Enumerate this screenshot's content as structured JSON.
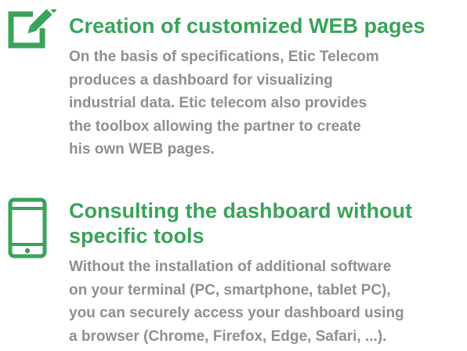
{
  "colors": {
    "accent": "#3aa35a",
    "body_text": "#8f8f8f"
  },
  "features": [
    {
      "icon": "edit-icon",
      "title_lines": [
        "Creation of customized WEB pages"
      ],
      "description_lines": [
        "On the basis of specifications, Etic Telecom",
        "produces a dashboard for visualizing",
        "industrial data. Etic telecom also provides",
        "the toolbox allowing the partner to create",
        "his own WEB pages."
      ]
    },
    {
      "icon": "tablet-icon",
      "title_lines": [
        "Consulting the dashboard without",
        "specific tools"
      ],
      "description_lines": [
        "Without the installation of additional software",
        "on your terminal (PC, smartphone, tablet PC),",
        "you can securely access your dashboard using",
        "a browser (Chrome, Firefox, Edge, Safari, ...)."
      ]
    }
  ]
}
